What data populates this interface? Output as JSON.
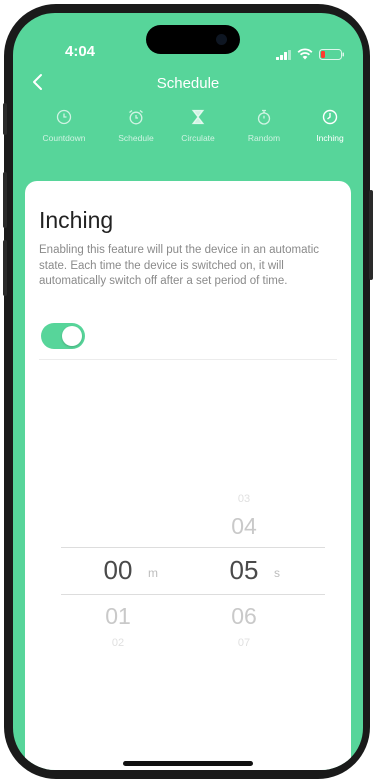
{
  "status_bar": {
    "time": "4:04"
  },
  "nav": {
    "title": "Schedule"
  },
  "tabs": [
    {
      "label": "Countdown",
      "icon": "clock-icon",
      "active": false
    },
    {
      "label": "Schedule",
      "icon": "alarm-clock-icon",
      "active": false
    },
    {
      "label": "Circulate",
      "icon": "hourglass-icon",
      "active": false
    },
    {
      "label": "Random",
      "icon": "stopwatch-icon",
      "active": false
    },
    {
      "label": "Inching",
      "icon": "timer-icon",
      "active": true
    }
  ],
  "panel": {
    "heading": "Inching",
    "description": "Enabling this feature will put the device in an automatic state. Each time the device is switched on, it will automatically switch off after a set period of time.",
    "toggle_on": true
  },
  "picker": {
    "minutes": {
      "selected": "00",
      "below": [
        "01",
        "02"
      ],
      "unit": "m"
    },
    "seconds": {
      "above": [
        "03",
        "04"
      ],
      "selected": "05",
      "below": [
        "06",
        "07"
      ],
      "unit": "s"
    }
  },
  "colors": {
    "accent": "#57d59a",
    "battery": "#ff3b30"
  }
}
